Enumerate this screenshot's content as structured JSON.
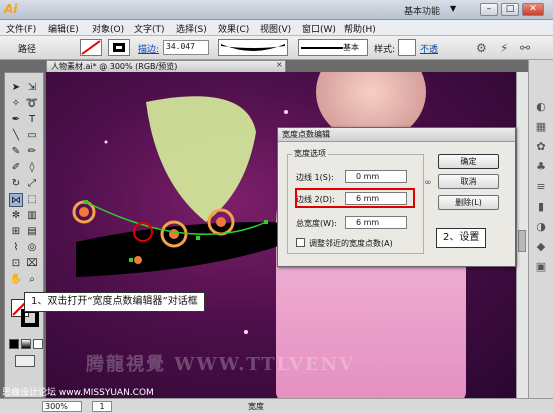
{
  "window": {
    "logo": "Ai",
    "workspace_label": "基本功能",
    "workspace_arrow": "▼",
    "min_label": "–",
    "max_label": "□",
    "close_label": "✕"
  },
  "menu": {
    "items": [
      "文件(F)",
      "编辑(E)",
      "对象(O)",
      "文字(T)",
      "选择(S)",
      "效果(C)",
      "视图(V)",
      "窗口(W)",
      "帮助(H)"
    ]
  },
  "controlbar": {
    "path_label": "路径",
    "stroke_label": "描边:",
    "stroke_value": "34.047",
    "profile_label": "基本",
    "opacity_label": "样式:",
    "transparency_label": "不透"
  },
  "document": {
    "tab_title": "人物素材.ai* @ 300% (RGB/预览)",
    "tab_close": "×",
    "watermark": "腾龍視覺 WWW.TTLVENV"
  },
  "statusbar": {
    "zoom": "300%",
    "page": "1",
    "mode": "宽度",
    "site": "思缘设计论坛 www.MISSYUAN.COM"
  },
  "dialog": {
    "title": "宽度点数编辑",
    "group_title": "宽度选项",
    "side1_label": "边线 1(S):",
    "side1_value": "0 mm",
    "side2_label": "边线 2(D):",
    "side2_value": "6 mm",
    "total_label": "总宽度(W):",
    "total_value": "6 mm",
    "adjust_label": "调整邻近的宽度点数(A)",
    "ok_label": "确定",
    "cancel_label": "取消",
    "delete_label": "删除(L)"
  },
  "annotations": {
    "step1": "1、双击打开“宽度点数编辑器”对话框",
    "step2": "2、设置"
  },
  "colors": {
    "highlight": "#e00000",
    "canvas_bg": "#4c0f4a",
    "dress": "#f3b6d8"
  },
  "icons": {
    "tools": [
      "selection-tool-icon",
      "direct-selection-tool-icon",
      "magic-wand-icon",
      "lasso-icon",
      "pen-tool-icon",
      "type-tool-icon",
      "line-tool-icon",
      "rectangle-tool-icon",
      "paintbrush-icon",
      "pencil-icon",
      "blob-brush-icon",
      "eraser-icon",
      "rotate-icon",
      "scale-icon",
      "width-tool-icon",
      "free-transform-icon",
      "symbol-sprayer-icon",
      "graph-tool-icon",
      "mesh-tool-icon",
      "gradient-tool-icon",
      "eyedropper-icon",
      "blend-tool-icon",
      "artboard-tool-icon",
      "slice-tool-icon",
      "hand-tool-icon",
      "zoom-tool-icon"
    ]
  }
}
